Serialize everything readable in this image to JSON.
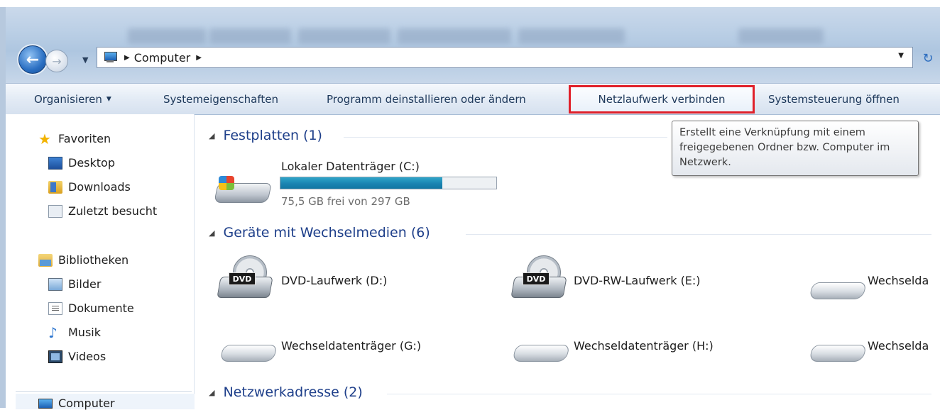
{
  "address_bar": {
    "crumb": "Computer",
    "location_icon": "computer-icon"
  },
  "commands": {
    "organize": "Organisieren",
    "system_properties": "Systemeigenschaften",
    "uninstall": "Programm deinstallieren oder ändern",
    "map_drive": "Netzlaufwerk verbinden",
    "control_panel": "Systemsteuerung öffnen"
  },
  "tooltip": {
    "text": "Erstellt eine Verknüpfung mit einem freigegebenen Ordner bzw. Computer im Netzwerk."
  },
  "nav": {
    "favorites": "Favoriten",
    "desktop": "Desktop",
    "downloads": "Downloads",
    "recent": "Zuletzt besucht",
    "libraries": "Bibliotheken",
    "pictures": "Bilder",
    "documents": "Dokumente",
    "music": "Musik",
    "videos": "Videos",
    "computer": "Computer"
  },
  "groups": {
    "hard_disks": "Festplatten (1)",
    "removable": "Geräte mit Wechselmedien (6)",
    "network": "Netzwerkadresse (2)"
  },
  "drives": {
    "c": {
      "name": "Lokaler Datenträger (C:)",
      "space": "75,5 GB frei von 297 GB",
      "used_fraction": 0.75
    },
    "d": {
      "name": "DVD-Laufwerk (D:)",
      "badge": "DVD"
    },
    "e": {
      "name": "DVD-RW-Laufwerk (E:)",
      "badge": "DVD"
    },
    "f": {
      "name": "Wechselda"
    },
    "g": {
      "name": "Wechseldatenträger (G:)"
    },
    "h": {
      "name": "Wechseldatenträger (H:)"
    },
    "i": {
      "name": "Wechselda"
    }
  },
  "colors": {
    "highlight_border": "#e0202a",
    "group_header": "#1e3f8a",
    "usage_bar": "#1b84b2"
  }
}
